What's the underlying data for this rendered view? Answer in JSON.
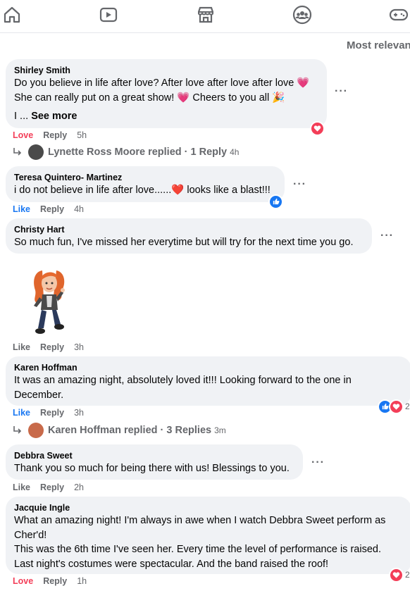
{
  "nav": {
    "icons": [
      "home-icon",
      "video-icon",
      "marketplace-icon",
      "groups-icon",
      "gaming-icon"
    ]
  },
  "sort_label": "Most relevant",
  "comments": [
    {
      "author": "Shirley Smith",
      "lines": [
        "Do you believe in life after love? After love after love after love 💗",
        "She can really put on a great show! 💗 Cheers to you all 🎉"
      ],
      "truncated": "I ...",
      "see_more": "See more",
      "reaction_label": "Love",
      "reply_label": "Reply",
      "time": "5h",
      "reactions": [
        "love"
      ],
      "replies": {
        "name": "Lynette Ross Moore",
        "text": "replied · 1 Reply",
        "time": "4h"
      }
    },
    {
      "author": "Teresa Quintero- Martinez",
      "lines": [
        "i do not believe in life after love......❤️ looks like a blast!!!"
      ],
      "reaction_label": "Like",
      "reply_label": "Reply",
      "time": "4h",
      "reactions": [
        "like"
      ]
    },
    {
      "author": "Christy Hart",
      "lines": [
        "So much fun, I've missed her everytime but will try for the next time you go."
      ],
      "reaction_label": "Like",
      "reply_label": "Reply",
      "time": "3h",
      "sticker": "avatar-sticker"
    },
    {
      "author": "Karen Hoffman",
      "lines": [
        "It was an amazing night, absolutely loved it!!! Looking forward to the one in",
        "December."
      ],
      "reaction_label": "Like",
      "reply_label": "Reply",
      "time": "3h",
      "reactions": [
        "like",
        "love"
      ],
      "reaction_count": "2",
      "replies": {
        "name": "Karen Hoffman",
        "text": "replied · 3 Replies",
        "time": "3m"
      }
    },
    {
      "author": "Debbra Sweet",
      "lines": [
        "Thank you so much for being there with us! Blessings to you."
      ],
      "reaction_label": "Like",
      "reply_label": "Reply",
      "time": "2h"
    },
    {
      "author": "Jacquie Ingle",
      "lines": [
        "What an amazing night! I'm always in awe when I watch Debbra Sweet perform as",
        "Cher'd!",
        "This was the 6th time I've seen her. Every time the level of performance is raised.",
        "Last night's costumes were spectacular. And the band raised the roof!"
      ],
      "reaction_label": "Love",
      "reply_label": "Reply",
      "time": "1h",
      "reactions": [
        "love"
      ],
      "reaction_count": "2"
    }
  ],
  "colors": {
    "love": "#f33e58",
    "like": "#1877f2",
    "bubble": "#f0f2f5",
    "secondary": "#65676b"
  }
}
